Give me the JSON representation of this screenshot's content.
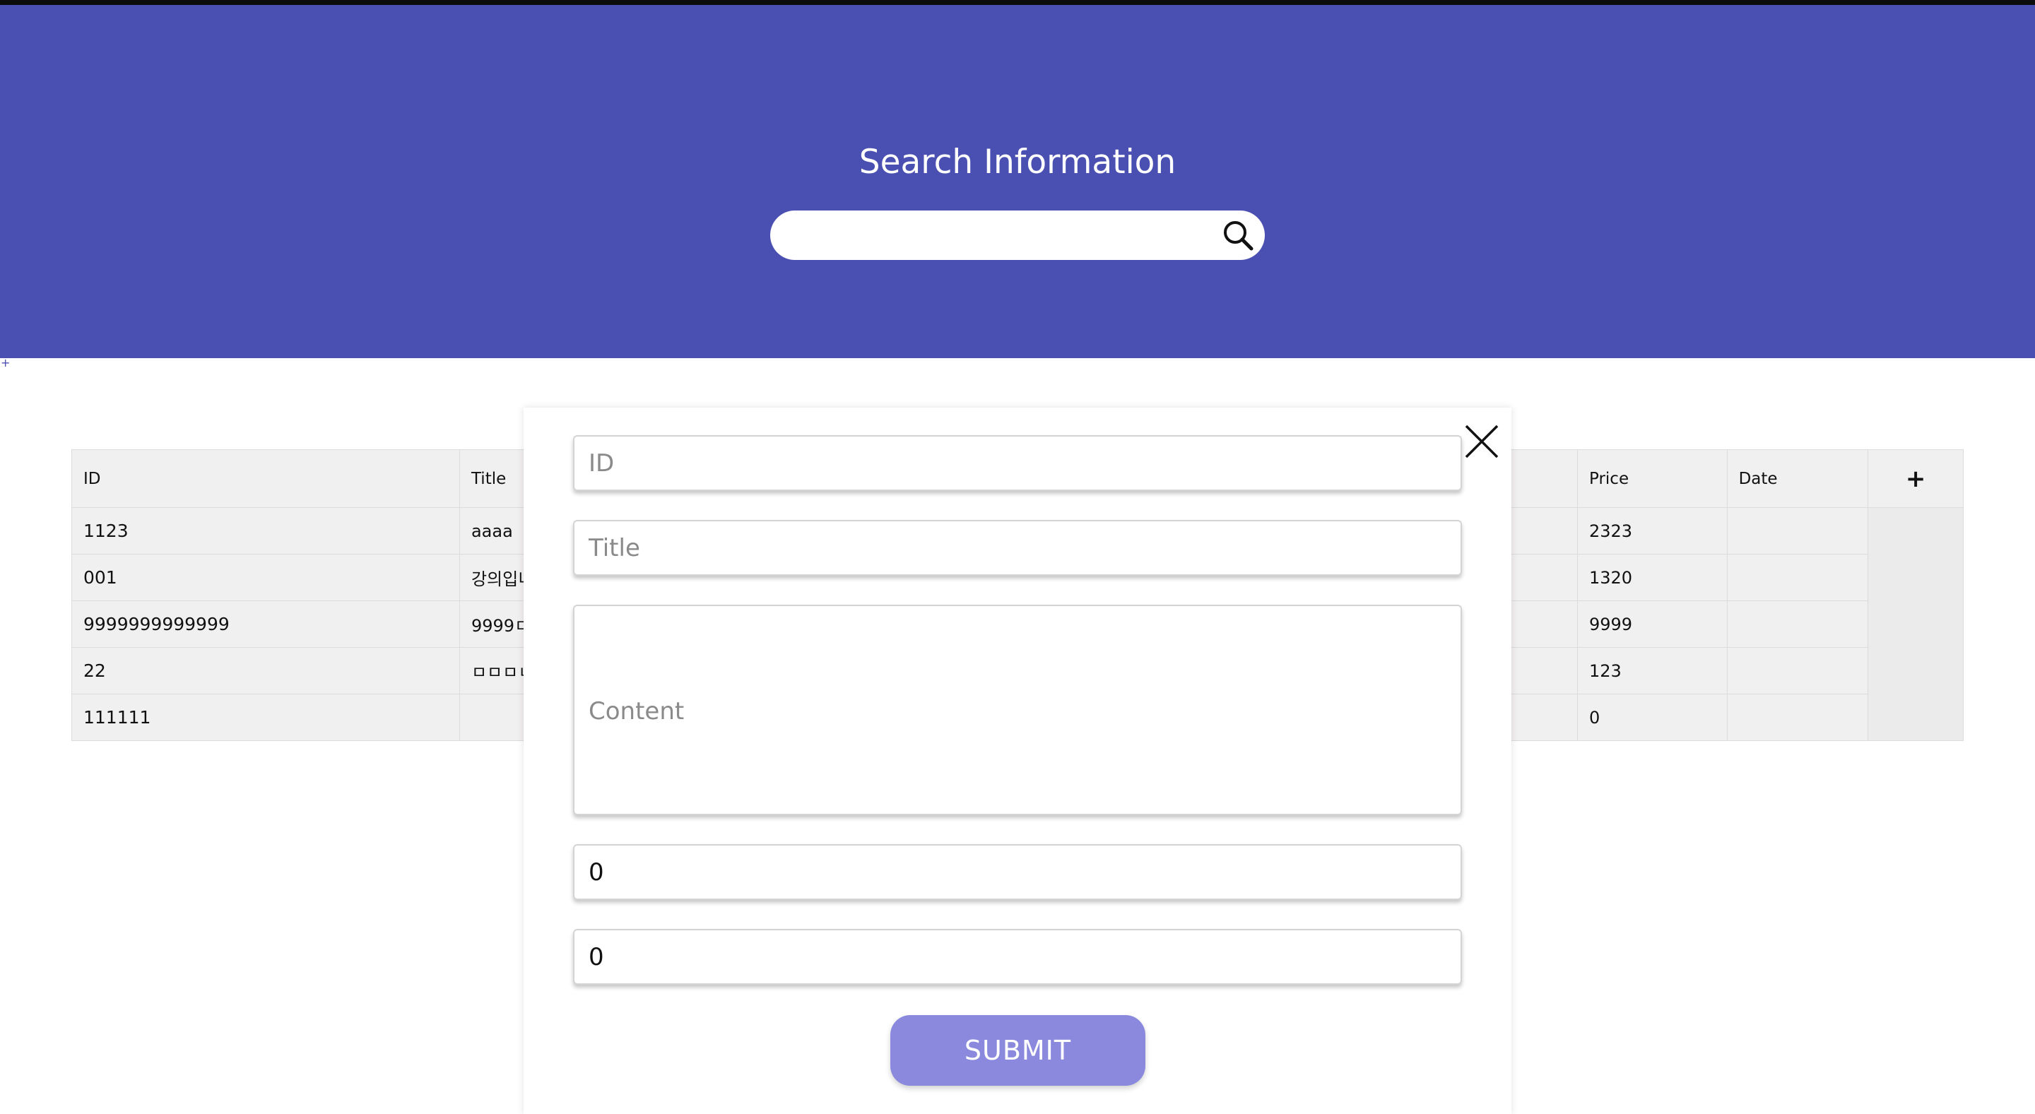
{
  "header": {
    "title": "Search Information",
    "search_value": "",
    "background_color": "#4a4fb2"
  },
  "small_add_glyph": "+",
  "table": {
    "columns": {
      "id": "ID",
      "title": "Title",
      "price": "Price",
      "date": "Date",
      "add": "+"
    },
    "rows": [
      {
        "id": "1123",
        "title": "aaaa",
        "price": "2323",
        "date": ""
      },
      {
        "id": "001",
        "title": "강의입니",
        "price": "1320",
        "date": ""
      },
      {
        "id": "9999999999999",
        "title": "9999ㅁ",
        "price": "9999",
        "date": ""
      },
      {
        "id": "22",
        "title": "ㅁㅁㅁㄴ",
        "price": "123",
        "date": ""
      },
      {
        "id": "111111",
        "title": "",
        "price": "0",
        "date": ""
      }
    ]
  },
  "modal": {
    "id_placeholder": "ID",
    "title_placeholder": "Title",
    "content_placeholder": "Content",
    "number1_value": "0",
    "number2_value": "0",
    "submit_label": "SUBMIT",
    "submit_color": "#8a89dd",
    "close_icon": "close-icon"
  }
}
